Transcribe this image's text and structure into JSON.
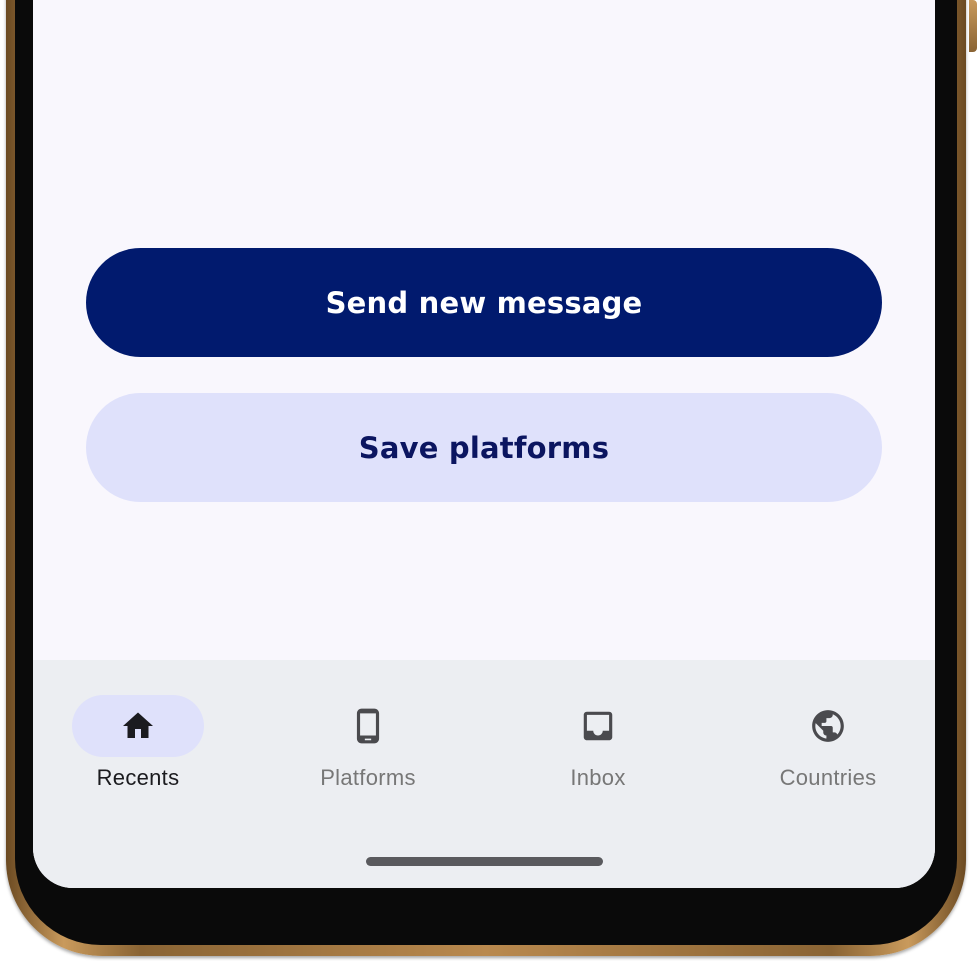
{
  "actions": {
    "send_new_message_label": "Send new message",
    "save_platforms_label": "Save platforms"
  },
  "bottom_nav": {
    "items": [
      {
        "label": "Recents",
        "icon": "home-icon",
        "active": true
      },
      {
        "label": "Platforms",
        "icon": "smartphone-icon",
        "active": false
      },
      {
        "label": "Inbox",
        "icon": "inbox-icon",
        "active": false
      },
      {
        "label": "Countries",
        "icon": "globe-icon",
        "active": false
      }
    ]
  },
  "colors": {
    "primary": "#011a6e",
    "secondary_container": "#dfe1fb",
    "on_secondary_container": "#0b1560",
    "screen_background": "#f9f7fd",
    "nav_background": "#eceef2",
    "nav_inactive": "#777777",
    "nav_active": "#1b1b1f"
  }
}
